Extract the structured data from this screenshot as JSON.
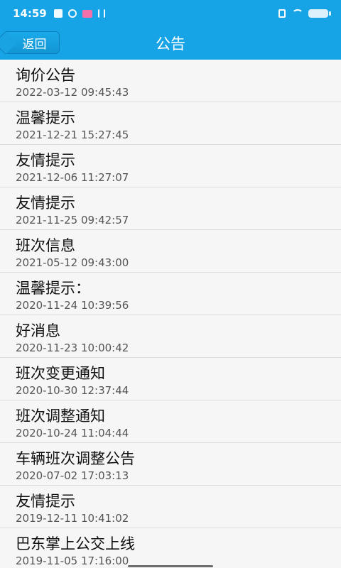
{
  "status_bar": {
    "time": "14:59",
    "left_icons": [
      "shield-icon",
      "circle-icon",
      "app-icon",
      "usb-icon"
    ],
    "right_icons": [
      "sim-icon",
      "wifi-icon",
      "battery-icon"
    ]
  },
  "navbar": {
    "back_label": "返回",
    "title": "公告"
  },
  "notices": [
    {
      "title": "询价公告",
      "date": "2022-03-12 09:45:43"
    },
    {
      "title": "温馨提示",
      "date": "2021-12-21 15:27:45"
    },
    {
      "title": "友情提示",
      "date": "2021-12-06 11:27:07"
    },
    {
      "title": "友情提示",
      "date": "2021-11-25 09:42:57"
    },
    {
      "title": "班次信息",
      "date": "2021-05-12 09:43:00"
    },
    {
      "title": "温馨提示：",
      "date": "2020-11-24 10:39:56"
    },
    {
      "title": "好消息",
      "date": "2020-11-23 10:00:42"
    },
    {
      "title": "班次变更通知",
      "date": "2020-10-30 12:37:44"
    },
    {
      "title": "班次调整通知",
      "date": "2020-10-24 11:04:44"
    },
    {
      "title": "车辆班次调整公告",
      "date": "2020-07-02 17:03:13"
    },
    {
      "title": "友情提示",
      "date": "2019-12-11 10:41:02"
    },
    {
      "title": "巴东掌上公交上线",
      "date": "2019-11-05 17:16:00"
    }
  ],
  "colors": {
    "primary": "#16a4e6",
    "list_bg": "#f6f6f6",
    "divider": "#dcdcdc"
  }
}
